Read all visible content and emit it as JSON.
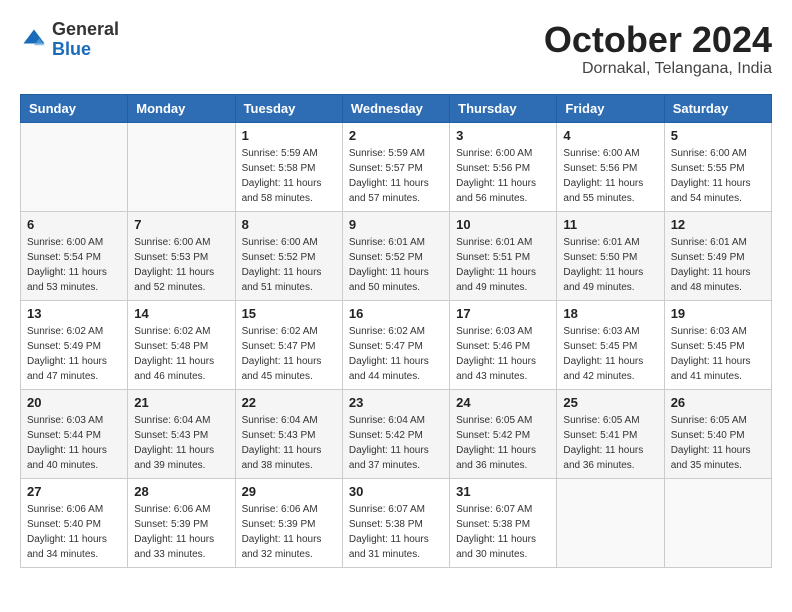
{
  "header": {
    "logo_general": "General",
    "logo_blue": "Blue",
    "month": "October 2024",
    "location": "Dornakal, Telangana, India"
  },
  "days_of_week": [
    "Sunday",
    "Monday",
    "Tuesday",
    "Wednesday",
    "Thursday",
    "Friday",
    "Saturday"
  ],
  "weeks": [
    [
      {
        "day": "",
        "info": ""
      },
      {
        "day": "",
        "info": ""
      },
      {
        "day": "1",
        "info": "Sunrise: 5:59 AM\nSunset: 5:58 PM\nDaylight: 11 hours and 58 minutes."
      },
      {
        "day": "2",
        "info": "Sunrise: 5:59 AM\nSunset: 5:57 PM\nDaylight: 11 hours and 57 minutes."
      },
      {
        "day": "3",
        "info": "Sunrise: 6:00 AM\nSunset: 5:56 PM\nDaylight: 11 hours and 56 minutes."
      },
      {
        "day": "4",
        "info": "Sunrise: 6:00 AM\nSunset: 5:56 PM\nDaylight: 11 hours and 55 minutes."
      },
      {
        "day": "5",
        "info": "Sunrise: 6:00 AM\nSunset: 5:55 PM\nDaylight: 11 hours and 54 minutes."
      }
    ],
    [
      {
        "day": "6",
        "info": "Sunrise: 6:00 AM\nSunset: 5:54 PM\nDaylight: 11 hours and 53 minutes."
      },
      {
        "day": "7",
        "info": "Sunrise: 6:00 AM\nSunset: 5:53 PM\nDaylight: 11 hours and 52 minutes."
      },
      {
        "day": "8",
        "info": "Sunrise: 6:00 AM\nSunset: 5:52 PM\nDaylight: 11 hours and 51 minutes."
      },
      {
        "day": "9",
        "info": "Sunrise: 6:01 AM\nSunset: 5:52 PM\nDaylight: 11 hours and 50 minutes."
      },
      {
        "day": "10",
        "info": "Sunrise: 6:01 AM\nSunset: 5:51 PM\nDaylight: 11 hours and 49 minutes."
      },
      {
        "day": "11",
        "info": "Sunrise: 6:01 AM\nSunset: 5:50 PM\nDaylight: 11 hours and 49 minutes."
      },
      {
        "day": "12",
        "info": "Sunrise: 6:01 AM\nSunset: 5:49 PM\nDaylight: 11 hours and 48 minutes."
      }
    ],
    [
      {
        "day": "13",
        "info": "Sunrise: 6:02 AM\nSunset: 5:49 PM\nDaylight: 11 hours and 47 minutes."
      },
      {
        "day": "14",
        "info": "Sunrise: 6:02 AM\nSunset: 5:48 PM\nDaylight: 11 hours and 46 minutes."
      },
      {
        "day": "15",
        "info": "Sunrise: 6:02 AM\nSunset: 5:47 PM\nDaylight: 11 hours and 45 minutes."
      },
      {
        "day": "16",
        "info": "Sunrise: 6:02 AM\nSunset: 5:47 PM\nDaylight: 11 hours and 44 minutes."
      },
      {
        "day": "17",
        "info": "Sunrise: 6:03 AM\nSunset: 5:46 PM\nDaylight: 11 hours and 43 minutes."
      },
      {
        "day": "18",
        "info": "Sunrise: 6:03 AM\nSunset: 5:45 PM\nDaylight: 11 hours and 42 minutes."
      },
      {
        "day": "19",
        "info": "Sunrise: 6:03 AM\nSunset: 5:45 PM\nDaylight: 11 hours and 41 minutes."
      }
    ],
    [
      {
        "day": "20",
        "info": "Sunrise: 6:03 AM\nSunset: 5:44 PM\nDaylight: 11 hours and 40 minutes."
      },
      {
        "day": "21",
        "info": "Sunrise: 6:04 AM\nSunset: 5:43 PM\nDaylight: 11 hours and 39 minutes."
      },
      {
        "day": "22",
        "info": "Sunrise: 6:04 AM\nSunset: 5:43 PM\nDaylight: 11 hours and 38 minutes."
      },
      {
        "day": "23",
        "info": "Sunrise: 6:04 AM\nSunset: 5:42 PM\nDaylight: 11 hours and 37 minutes."
      },
      {
        "day": "24",
        "info": "Sunrise: 6:05 AM\nSunset: 5:42 PM\nDaylight: 11 hours and 36 minutes."
      },
      {
        "day": "25",
        "info": "Sunrise: 6:05 AM\nSunset: 5:41 PM\nDaylight: 11 hours and 36 minutes."
      },
      {
        "day": "26",
        "info": "Sunrise: 6:05 AM\nSunset: 5:40 PM\nDaylight: 11 hours and 35 minutes."
      }
    ],
    [
      {
        "day": "27",
        "info": "Sunrise: 6:06 AM\nSunset: 5:40 PM\nDaylight: 11 hours and 34 minutes."
      },
      {
        "day": "28",
        "info": "Sunrise: 6:06 AM\nSunset: 5:39 PM\nDaylight: 11 hours and 33 minutes."
      },
      {
        "day": "29",
        "info": "Sunrise: 6:06 AM\nSunset: 5:39 PM\nDaylight: 11 hours and 32 minutes."
      },
      {
        "day": "30",
        "info": "Sunrise: 6:07 AM\nSunset: 5:38 PM\nDaylight: 11 hours and 31 minutes."
      },
      {
        "day": "31",
        "info": "Sunrise: 6:07 AM\nSunset: 5:38 PM\nDaylight: 11 hours and 30 minutes."
      },
      {
        "day": "",
        "info": ""
      },
      {
        "day": "",
        "info": ""
      }
    ]
  ]
}
